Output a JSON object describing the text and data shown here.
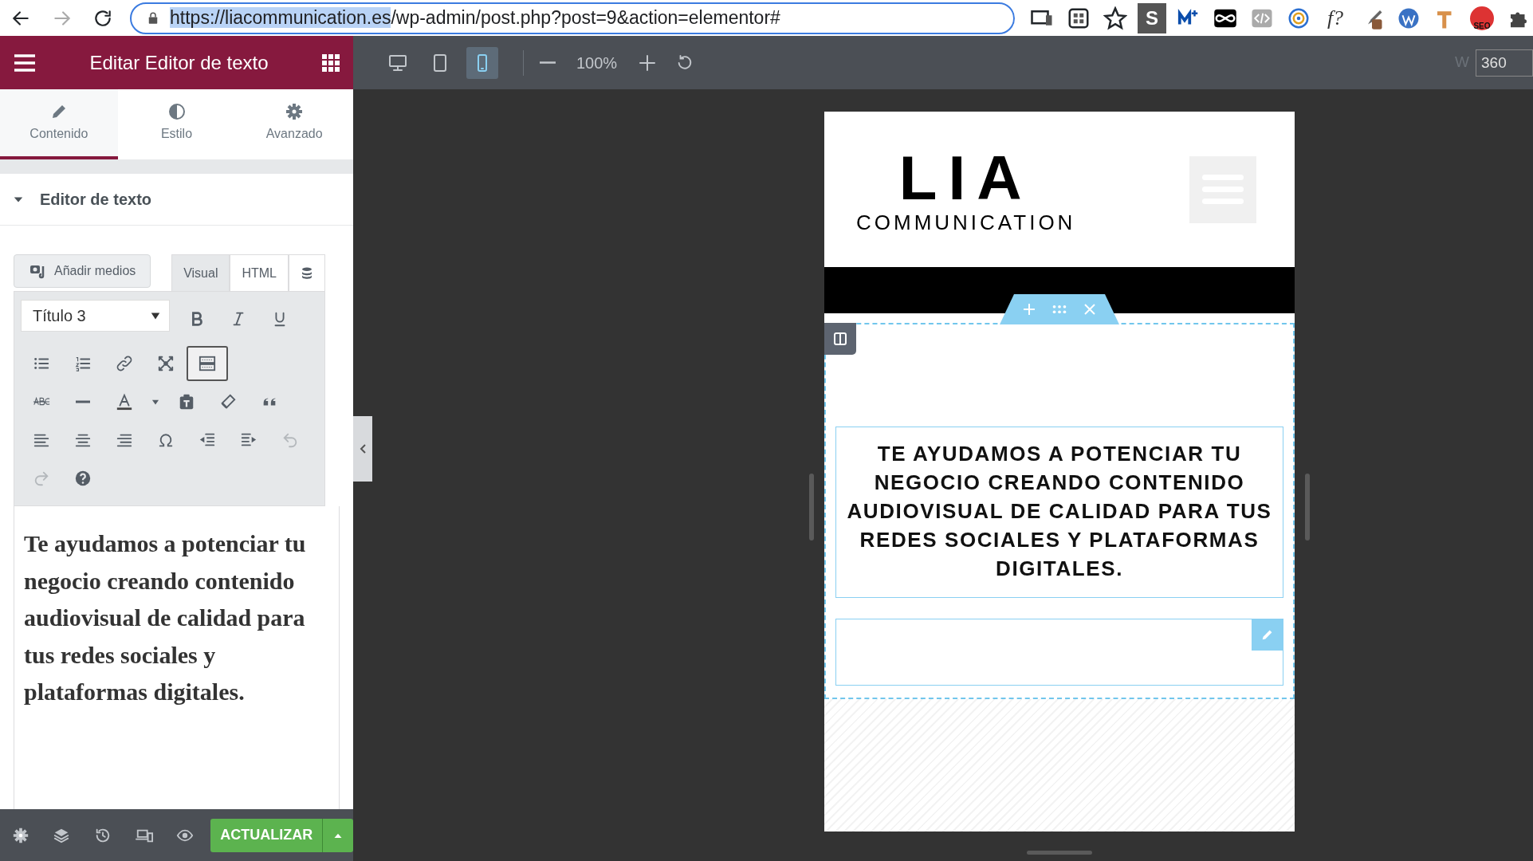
{
  "browser": {
    "url_host": "https://liacommunication.es",
    "url_path": "/wp-admin/post.php?post=9&action=elementor#",
    "extensions": [
      {
        "kind": "cast"
      },
      {
        "kind": "qr"
      },
      {
        "kind": "star"
      },
      {
        "kind": "letter",
        "label": "S"
      },
      {
        "kind": "mplus"
      },
      {
        "kind": "infinity"
      },
      {
        "kind": "code"
      },
      {
        "kind": "target"
      },
      {
        "kind": "letter-plain",
        "label": "f?"
      },
      {
        "kind": "dropper"
      },
      {
        "kind": "wp"
      },
      {
        "kind": "hammer"
      },
      {
        "kind": "seo",
        "label": "SEO"
      },
      {
        "kind": "puzzle"
      }
    ]
  },
  "panel": {
    "title": "Editar Editor de texto",
    "tabs": [
      {
        "label": "Contenido",
        "selected": true
      },
      {
        "label": "Estilo",
        "selected": false
      },
      {
        "label": "Avanzado",
        "selected": false
      }
    ],
    "section": {
      "title": "Editor de texto",
      "expanded": true
    },
    "add_media": "Añadir medios",
    "editor_tabs": [
      {
        "label": "Visual",
        "selected": true
      },
      {
        "label": "HTML",
        "selected": false
      }
    ],
    "format_select": "Título 3",
    "toolbar": [
      {
        "kind": "bold",
        "active": false,
        "disabled": false
      },
      {
        "kind": "italic",
        "active": false,
        "disabled": false
      },
      {
        "kind": "underline",
        "active": false,
        "disabled": false
      },
      {
        "kind": "bullets",
        "active": false,
        "disabled": false
      },
      {
        "kind": "numbers",
        "active": false,
        "disabled": false
      },
      {
        "kind": "link",
        "active": false,
        "disabled": false
      },
      {
        "kind": "fullscreen",
        "active": false,
        "disabled": false
      },
      {
        "kind": "keyboard",
        "active": true,
        "disabled": false
      },
      {
        "kind": "strike",
        "active": false,
        "disabled": false
      },
      {
        "kind": "hr",
        "active": false,
        "disabled": false
      },
      {
        "kind": "textcolor",
        "active": false,
        "disabled": false
      },
      {
        "kind": "caret",
        "active": false,
        "disabled": false
      },
      {
        "kind": "paste",
        "active": false,
        "disabled": false
      },
      {
        "kind": "eraser",
        "active": false,
        "disabled": false
      },
      {
        "kind": "quote",
        "active": false,
        "disabled": false
      },
      {
        "kind": "align-left",
        "active": false,
        "disabled": false
      },
      {
        "kind": "align-center",
        "active": false,
        "disabled": false
      },
      {
        "kind": "align-right",
        "active": false,
        "disabled": false
      },
      {
        "kind": "omega",
        "active": false,
        "disabled": false
      },
      {
        "kind": "outdent",
        "active": false,
        "disabled": false
      },
      {
        "kind": "indent",
        "active": false,
        "disabled": false
      },
      {
        "kind": "undo",
        "active": false,
        "disabled": true
      },
      {
        "kind": "redo",
        "active": false,
        "disabled": true
      },
      {
        "kind": "help",
        "active": false,
        "disabled": false
      }
    ],
    "content": "Te ayudamos a potenciar tu negocio creando contenido audiovisual de calidad para tus redes sociales y plataformas digitales.",
    "update_button": "ACTUALIZAR"
  },
  "preview_toolbar": {
    "devices": [
      {
        "kind": "desktop",
        "selected": false
      },
      {
        "kind": "tablet",
        "selected": false
      },
      {
        "kind": "mobile",
        "selected": true
      }
    ],
    "zoom": "100%",
    "width_label": "W",
    "width_value": "360"
  },
  "preview": {
    "logo_big": "LIA",
    "logo_word": "COMMUNICATION",
    "heading": "TE AYUDAMOS A POTENCIAR TU NEGOCIO CREANDO CONTENIDO AUDIOVISUAL DE CALIDAD PARA TUS REDES SOCIALES Y PLATAFORMAS DIGITALES."
  }
}
